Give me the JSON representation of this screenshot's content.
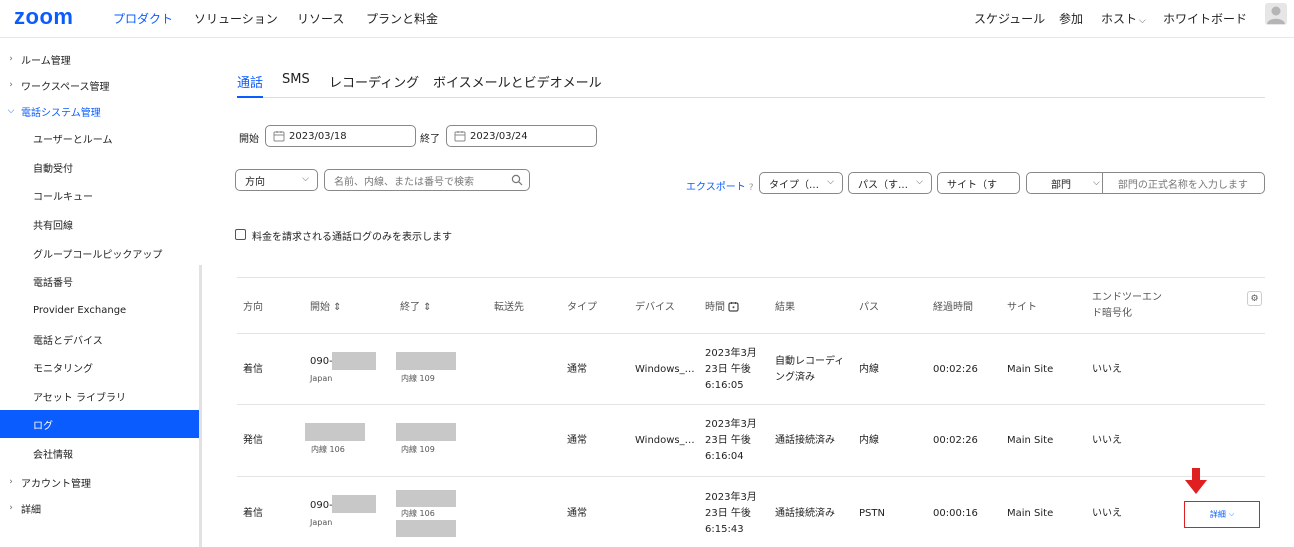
{
  "topnav": {
    "logo": "zoom",
    "items": [
      "プロダクト",
      "ソリューション",
      "リソース",
      "プランと料金"
    ],
    "right_items": [
      "スケジュール",
      "参加",
      "ホスト",
      "ホワイトボード"
    ]
  },
  "sidebar": {
    "items": [
      {
        "label": "ルーム管理",
        "level": "top"
      },
      {
        "label": "ワークスペース管理",
        "level": "top"
      },
      {
        "label": "電話システム管理",
        "level": "top",
        "open": true
      },
      {
        "label": "ユーザーとルーム",
        "level": "sub"
      },
      {
        "label": "自動受付",
        "level": "sub"
      },
      {
        "label": "コールキュー",
        "level": "sub"
      },
      {
        "label": "共有回線",
        "level": "sub"
      },
      {
        "label": "グループコールピックアップ",
        "level": "sub"
      },
      {
        "label": "電話番号",
        "level": "sub"
      },
      {
        "label": "Provider Exchange",
        "level": "sub"
      },
      {
        "label": "電話とデバイス",
        "level": "sub"
      },
      {
        "label": "モニタリング",
        "level": "sub"
      },
      {
        "label": "アセット ライブラリ",
        "level": "sub"
      },
      {
        "label": "ログ",
        "level": "sub",
        "selected": true
      },
      {
        "label": "会社情報",
        "level": "sub"
      },
      {
        "label": "アカウント管理",
        "level": "top"
      },
      {
        "label": "詳細",
        "level": "top"
      }
    ]
  },
  "tabs": [
    "通話",
    "SMS",
    "レコーディング",
    "ボイスメールとビデオメール"
  ],
  "filters": {
    "start_label": "開始",
    "start_date": "2023/03/18",
    "end_label": "終了",
    "end_date": "2023/03/24",
    "direction": "方向",
    "search_placeholder": "名前、内線、または番号で検索",
    "export": "エクスポート",
    "export_help": "?",
    "type": "タイプ（…",
    "path": "パス（す…",
    "site": "サイト（す",
    "department": "部門",
    "department_placeholder": "部門の正式名称を入力します",
    "billed_only": "料金を請求される通話ログのみを表示します"
  },
  "table": {
    "headers": {
      "direction": "方向",
      "start": "開始 ⇕",
      "end": "終了 ⇕",
      "forward": "転送先",
      "type": "タイプ",
      "device": "デバイス",
      "time": "時間",
      "result": "結果",
      "path": "パス",
      "elapsed": "経過時間",
      "site": "サイト",
      "e2ee_1": "エンドツーエン",
      "e2ee_2": "ド暗号化"
    },
    "rows": [
      {
        "direction": "着信",
        "start_number": "090-",
        "start_sub": "Japan",
        "end_sub": "内線 109",
        "type": "通常",
        "device": "Windows_…",
        "time_1": "2023年3月",
        "time_2": "23日 午後",
        "time_3": "6:16:05",
        "result_1": "自動レコーディ",
        "result_2": "ング済み",
        "path": "内線",
        "elapsed": "00:02:26",
        "site": "Main Site",
        "e2ee": "いいえ"
      },
      {
        "direction": "発信",
        "start_sub": "内線 106",
        "end_sub": "内線 109",
        "type": "通常",
        "device": "Windows_…",
        "time_1": "2023年3月",
        "time_2": "23日 午後",
        "time_3": "6:16:04",
        "result_1": "通話接続済み",
        "path": "内線",
        "elapsed": "00:02:26",
        "site": "Main Site",
        "e2ee": "いいえ"
      },
      {
        "direction": "着信",
        "start_number": "090-",
        "start_sub": "Japan",
        "end_sub": "内線 106",
        "type": "通常",
        "time_1": "2023年3月",
        "time_2": "23日 午後",
        "time_3": "6:15:43",
        "result_1": "通話接続済み",
        "path": "PSTN",
        "elapsed": "00:00:16",
        "site": "Main Site",
        "e2ee": "いいえ",
        "detail": "詳細"
      }
    ]
  },
  "colors": {
    "accent": "#0b5cff",
    "highlight": "#e02020"
  }
}
